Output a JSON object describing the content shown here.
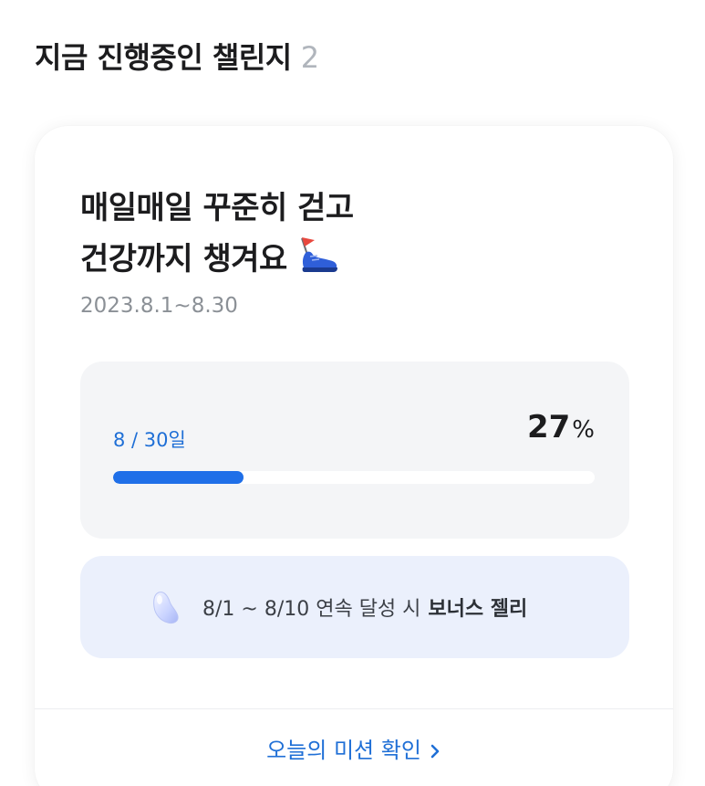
{
  "section": {
    "title": "지금 진행중인 챌린지",
    "count": "2"
  },
  "challenge": {
    "title_line1": "매일매일 꾸준히 걷고",
    "title_line2": "건강까지 챙겨요",
    "title_icon": "running-shoe-icon",
    "period": "2023.8.1~8.30",
    "progress": {
      "days_label": "8 / 30일",
      "percent_value": "27",
      "percent_sign": "%",
      "fraction": 0.27
    },
    "bonus": {
      "icon": "jelly-bean-icon",
      "condition": "8/1 ~ 8/10 연속 달성 시",
      "reward": "보너스 젤리"
    },
    "mission_link": {
      "label": "오늘의 미션 확인",
      "icon": "chevron-right-icon"
    }
  },
  "colors": {
    "accent": "#1f6fe8",
    "link": "#1f6fd6",
    "bonus_bg": "#ebf0fc",
    "progress_bg": "#f4f5f7"
  }
}
